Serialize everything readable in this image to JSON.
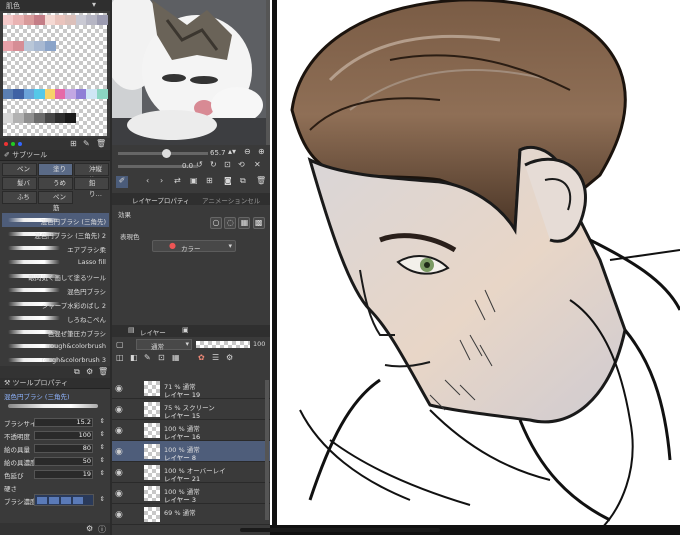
{
  "color_set": {
    "title": "肌色",
    "swatches_row1": [
      "#f3c9c9",
      "#e9b3b3",
      "#d89a9a",
      "#c47d86",
      "#f5d9d3",
      "#eac4bd",
      "#dcc0ba",
      "#c9c9d3",
      "#b6b6c4",
      "#9c9cb1"
    ],
    "swatches_row2": [
      "#e7a0a8",
      "#d68d95",
      "#b9c7d8",
      "#a8b9d2",
      "#8ba4c9"
    ],
    "swatches_bottom1": [
      "#5a7fb3",
      "#3f62a4",
      "#6aa3d9",
      "#55c8e8",
      "#f7d26a",
      "#e66aa8",
      "#c3a7e3",
      "#8f7fd6",
      "#cfe6f5",
      "#8bd6c3"
    ],
    "swatches_bottom2": [
      "#d6d6d6",
      "#b2b2b2",
      "#8f8f8f",
      "#6b6b6b",
      "#474747",
      "#2e2e2e",
      "#1a1a1a"
    ]
  },
  "sub_tool": {
    "header": "サブツール",
    "tools": [
      {
        "label": "ペン",
        "active": false
      },
      {
        "label": "塗り",
        "active": true
      },
      {
        "label": "沖縦筋",
        "active": false
      },
      {
        "label": "髪バイ",
        "active": false
      },
      {
        "label": "うめた",
        "active": false
      },
      {
        "label": "鉛り…",
        "active": false
      },
      {
        "label": "ふち",
        "active": false
      },
      {
        "label": "ペン筋",
        "active": false
      }
    ],
    "brushes": [
      "混色円ブラシ (三角先)",
      "混色円ブラシ (三角先) 2",
      "エアブラシ柔",
      "Lasso fill",
      "眼閃気く画して塗るツール",
      "混色円ブラシ",
      "シャープ水彩のばし 2",
      "しろねこぺん",
      "色混ぜ筆圧カブラシ",
      "rough&colorbrush",
      "rough&colorbrush 3"
    ]
  },
  "tool_property": {
    "header": "ツールプロパティ",
    "brush_name": "混色円ブラシ (三角先)",
    "rows": [
      {
        "label": "ブラシサイズ",
        "value": "15.2"
      },
      {
        "label": "不透明度",
        "value": "100"
      },
      {
        "label": "絵の具量",
        "value": "80"
      },
      {
        "label": "絵の具濃度",
        "value": "50"
      },
      {
        "label": "色延び",
        "value": "19"
      },
      {
        "label": "硬さ",
        "value": ""
      },
      {
        "label": "ブラシ濃度",
        "value": "100"
      }
    ]
  },
  "navigator": {
    "zoom": "65.7",
    "rotation": "0.0"
  },
  "layer_property": {
    "tabs": [
      "レイヤープロパティ",
      "アニメーションセル"
    ],
    "effect_label": "効果",
    "expression_label": "表現色",
    "expression_value": "カラー"
  },
  "layer_panel": {
    "tab": "レイヤー",
    "blend_mode": "通常",
    "opacity": "100",
    "layers": [
      {
        "mode": "71 %  通常",
        "name": "レイヤー 19",
        "selected": false
      },
      {
        "mode": "75 %  スクリーン",
        "name": "レイヤー 15",
        "selected": false
      },
      {
        "mode": "100 %  通常",
        "name": "レイヤー 16",
        "selected": false
      },
      {
        "mode": "100 %  通常",
        "name": "レイヤー 8",
        "selected": true
      },
      {
        "mode": "100 %  オーバーレイ",
        "name": "レイヤー 21",
        "selected": false
      },
      {
        "mode": "100 %  通常",
        "name": "レイヤー 3",
        "selected": false
      },
      {
        "mode": "69 %  通常",
        "name": "",
        "selected": false
      }
    ]
  }
}
